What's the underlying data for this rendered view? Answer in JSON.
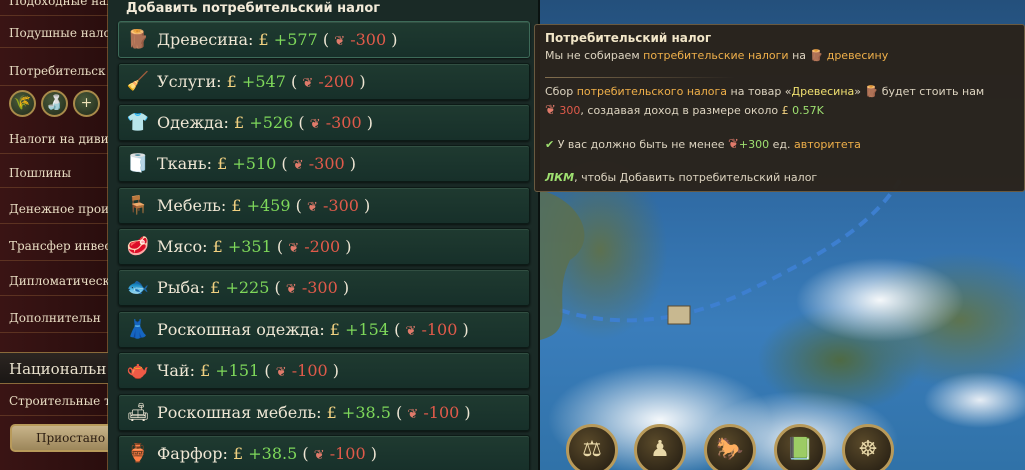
{
  "sidebar": {
    "items": [
      {
        "label": "Подоходные нал"
      },
      {
        "label": "Подушные нало"
      },
      {
        "label": "Потребительск"
      },
      {
        "label": "Налоги на диви"
      },
      {
        "label": "Пошлины"
      },
      {
        "label": "Денежное прои"
      },
      {
        "label": "Трансфер инвес"
      },
      {
        "label": "Дипломатическ"
      },
      {
        "label": "Дополнительн"
      }
    ],
    "icons": [
      {
        "name": "wheat-icon",
        "glyph": "🌾"
      },
      {
        "name": "bottle-icon",
        "glyph": "🍶"
      },
      {
        "name": "plus-icon",
        "glyph": "+"
      }
    ],
    "section_label": "Национальн",
    "sub_label": "Строительные т",
    "pause_button": "Приостано"
  },
  "panel": {
    "title": "Добавить потребительский налог",
    "rows": [
      {
        "icon": "🪵",
        "icon_name": "wood-icon",
        "good": "Древесина:",
        "money": "£",
        "income": "+577",
        "authority": "-300"
      },
      {
        "icon": "🧹",
        "icon_name": "services-icon",
        "good": "Услуги:",
        "money": "£",
        "income": "+547",
        "authority": "-200"
      },
      {
        "icon": "👕",
        "icon_name": "clothes-icon",
        "good": "Одежда:",
        "money": "£",
        "income": "+526",
        "authority": "-300"
      },
      {
        "icon": "🧻",
        "icon_name": "fabric-icon",
        "good": "Ткань:",
        "money": "£",
        "income": "+510",
        "authority": "-300"
      },
      {
        "icon": "🪑",
        "icon_name": "furniture-icon",
        "good": "Мебель:",
        "money": "£",
        "income": "+459",
        "authority": "-300"
      },
      {
        "icon": "🥩",
        "icon_name": "meat-icon",
        "good": "Мясо:",
        "money": "£",
        "income": "+351",
        "authority": "-200"
      },
      {
        "icon": "🐟",
        "icon_name": "fish-icon",
        "good": "Рыба:",
        "money": "£",
        "income": "+225",
        "authority": "-300"
      },
      {
        "icon": "👗",
        "icon_name": "luxury-clothes-icon",
        "good": "Роскошная одежда:",
        "money": "£",
        "income": "+154",
        "authority": "-100"
      },
      {
        "icon": "🫖",
        "icon_name": "tea-icon",
        "good": "Чай:",
        "money": "£",
        "income": "+151",
        "authority": "-100"
      },
      {
        "icon": "🛋",
        "icon_name": "luxury-furniture-icon",
        "good": "Роскошная мебель:",
        "money": "£",
        "income": "+38.5",
        "authority": "-100"
      },
      {
        "icon": "🏺",
        "icon_name": "porcelain-icon",
        "good": "Фарфор:",
        "money": "£",
        "income": "+38.5",
        "authority": "-100"
      }
    ],
    "paren_open": "(",
    "paren_close": ")",
    "authority_glyph": "❦"
  },
  "tooltip": {
    "title": "Потребительский налог",
    "l1_a": "Мы не собираем",
    "l1_b": "потребительские налоги",
    "l1_c": "на",
    "l1_d": "древесину",
    "l2_a": "Сбор",
    "l2_b": "потребительского налога",
    "l2_c": "на товар «",
    "l2_d": "Древесина",
    "l2_e": "»",
    "l2_f": "будет стоить нам",
    "l3_a": "300",
    "l3_b": ", создавая доход в размере около",
    "l3_c": "£",
    "l3_d": "0.57K",
    "l4_a": "У вас должно быть не менее",
    "l4_b": "+300",
    "l4_c": "ед.",
    "l4_d": "авторитета",
    "l5_a": "ЛКМ",
    "l5_b": ", чтобы Добавить потребительский налог"
  },
  "map_buttons": [
    {
      "name": "justice-scales-icon",
      "glyph": "⚖"
    },
    {
      "name": "pawn-icon",
      "glyph": "♟"
    },
    {
      "name": "cavalry-icon",
      "glyph": "🐎"
    },
    {
      "name": "ledger-icon",
      "glyph": "📗"
    },
    {
      "name": "wheel-icon",
      "glyph": "☸"
    }
  ]
}
